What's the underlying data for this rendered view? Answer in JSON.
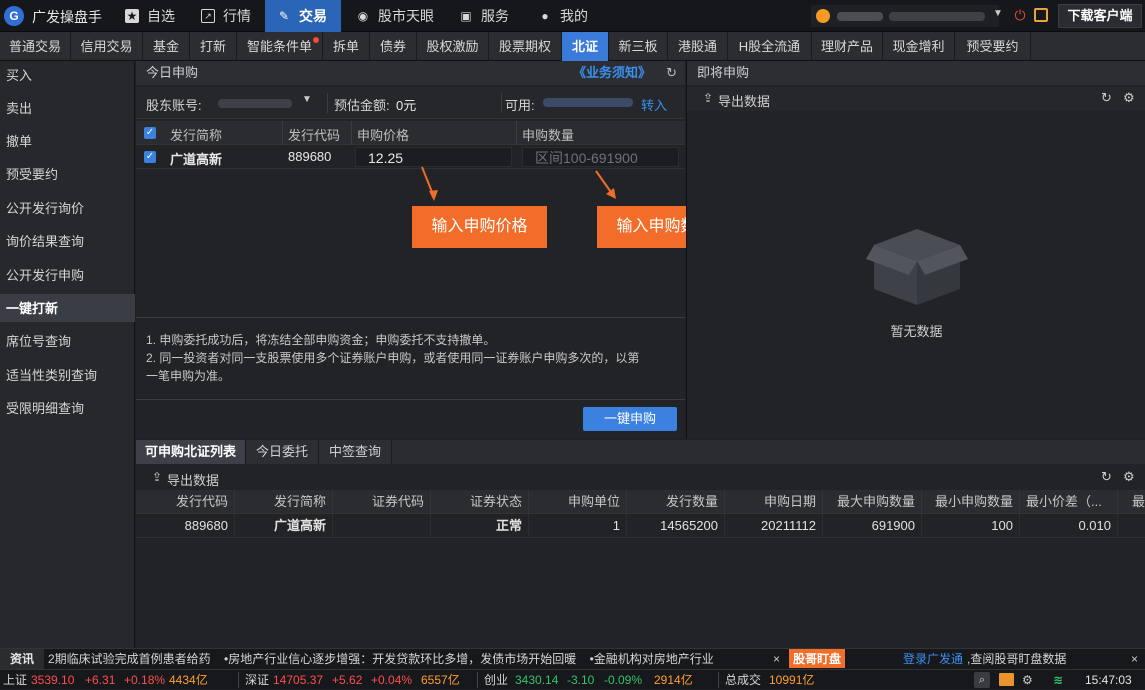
{
  "app": {
    "name": "广发操盘手",
    "logo": "G"
  },
  "nav": [
    {
      "label": "自选",
      "icon": "star-icon"
    },
    {
      "label": "行情",
      "icon": "chart-icon"
    },
    {
      "label": "交易",
      "icon": "trade-icon"
    },
    {
      "label": "股市天眼",
      "icon": "eye-icon"
    },
    {
      "label": "服务",
      "icon": "briefcase-icon"
    },
    {
      "label": "我的",
      "icon": "user-icon"
    }
  ],
  "download_label": "下载客户端",
  "subtabs": [
    "普通交易",
    "信用交易",
    "基金",
    "打新",
    "智能条件单",
    "拆单",
    "债券",
    "股权激励",
    "股票期权",
    "北证",
    "新三板",
    "港股通",
    "H股全流通",
    "理财产品",
    "现金增利",
    "预受要约"
  ],
  "sidebar": [
    "买入",
    "卖出",
    "撤单",
    "预受要约",
    "公开发行询价",
    "询价结果查询",
    "公开发行申购",
    "一键打新",
    "席位号查询",
    "适当性类别查询",
    "受限明细查询"
  ],
  "today": {
    "title": "今日申购",
    "notice_link": "《业务须知》",
    "account_label": "股东账号:",
    "estimate_label": "预估金额:",
    "estimate_value": "0元",
    "available_label": "可用:",
    "transfer_label": "转入",
    "headers": [
      "发行简称",
      "发行代码",
      "申购价格",
      "申购数量"
    ],
    "row": {
      "name": "广道高新",
      "code": "889680",
      "price": "12.25",
      "qty_placeholder": "区间100-691900"
    },
    "callout_price": "输入申购价格",
    "callout_qty": "输入申购数量",
    "notes": [
      "1. 申购委托成功后，将冻结全部申购资金；申购委托不支持撤单。",
      "2. 同一投资者对同一支股票使用多个证券账户申购，或者使用同一证券账户申购多次的，以第",
      "一笔申购为准。"
    ],
    "submit_label": "一键申购"
  },
  "upcoming": {
    "title": "即将申购",
    "export_label": "导出数据",
    "empty_label": "暂无数据"
  },
  "bottom": {
    "tabs": [
      "可申购北证列表",
      "今日委托",
      "中签查询"
    ],
    "export_label": "导出数据",
    "headers": [
      "发行代码",
      "发行简称",
      "证券代码",
      "证券状态",
      "申购单位",
      "发行数量",
      "申购日期",
      "最大申购数量",
      "最小申购数量",
      "最小价差（...",
      "最"
    ],
    "rows": [
      [
        "889680",
        "广道高新",
        "",
        "正常",
        "1",
        "14565200",
        "20211112",
        "691900",
        "100",
        "0.010",
        ""
      ]
    ]
  },
  "news": {
    "tag": "资讯",
    "items": [
      "2期临床试验完成首例患者给药",
      "•房地产行业信心逐步增强：开发贷款环比多增，发债市场开始回暖",
      "•金融机构对房地产行业"
    ],
    "badge": "股哥盯盘",
    "login_link": "登录广发通",
    "login_text": ",查阅股哥盯盘数据"
  },
  "status": {
    "sh": {
      "label": "上证",
      "value": "3539.10",
      "change": "+6.31",
      "pct": "+0.18%",
      "amount": "4434亿"
    },
    "sz": {
      "label": "深证",
      "value": "14705.37",
      "change": "+5.62",
      "pct": "+0.04%",
      "amount": "6557亿"
    },
    "cy": {
      "label": "创业",
      "value": "3430.14",
      "change": "-3.10",
      "pct": "-0.09%",
      "amount": "2914亿"
    },
    "total": {
      "label": "总成交",
      "value": "10991亿"
    },
    "time": "15:47:03"
  },
  "colors": {
    "accent": "#3a7ad9",
    "callout": "#f26c2a",
    "up": "#ff4d4d",
    "down": "#2fc46b"
  }
}
